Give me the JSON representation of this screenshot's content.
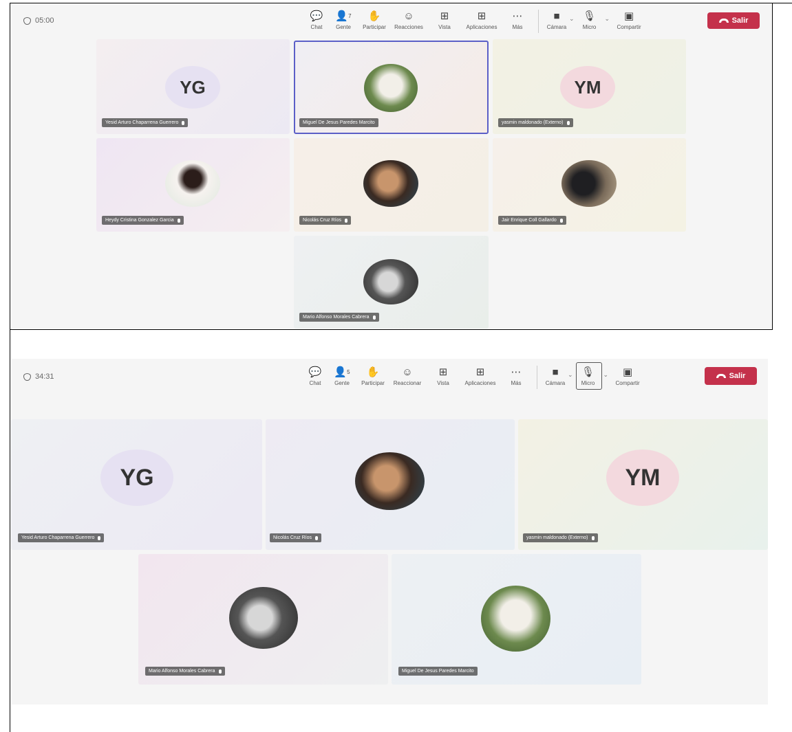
{
  "screens": [
    {
      "timer": "05:00",
      "people_count": "7",
      "toolbar": {
        "chat": "Chat",
        "people": "Gente",
        "raise": "Participar",
        "react": "Reacciones",
        "view": "Vista",
        "apps": "Aplicaciones",
        "more": "Más",
        "camera": "Cámara",
        "mic": "Micro",
        "share": "Compartir",
        "leave": "Salir"
      },
      "tiles": [
        {
          "name": "Yesid Arturo Chaparrena Guerrero",
          "initials": "YG",
          "initials_bg": "#e6e1f2"
        },
        {
          "name": "Miguel De Jesus Paredes Marcito"
        },
        {
          "name": "yasmin maldonado (Externo)",
          "initials": "YM",
          "initials_bg": "#f3d9de"
        },
        {
          "name": "Heydy Cristina Gonzalez Garcia"
        },
        {
          "name": "Nicolás Cruz Ríos"
        },
        {
          "name": "Jair Enrique Coll Gallardo"
        },
        {
          "name": "Mario Alfonso Morales Cabrera"
        }
      ]
    },
    {
      "timer": "34:31",
      "people_count": "5",
      "toolbar": {
        "chat": "Chat",
        "people": "Gente",
        "raise": "Participar",
        "react": "Reaccionar",
        "view": "Vista",
        "apps": "Aplicaciones",
        "more": "Más",
        "camera": "Cámara",
        "mic": "Micro",
        "share": "Compartir",
        "leave": "Salir"
      },
      "tiles": [
        {
          "name": "Yesid Arturo Chaparrena Guerrero",
          "initials": "YG",
          "initials_bg": "#e6e1f2"
        },
        {
          "name": "Nicolás Cruz Ríos"
        },
        {
          "name": "yasmin maldonado (Externo)",
          "initials": "YM",
          "initials_bg": "#f3d9de"
        },
        {
          "name": "Mario Alfonso Morales Cabrera"
        },
        {
          "name": "Miguel De Jesus Paredes Marcito"
        }
      ]
    }
  ]
}
